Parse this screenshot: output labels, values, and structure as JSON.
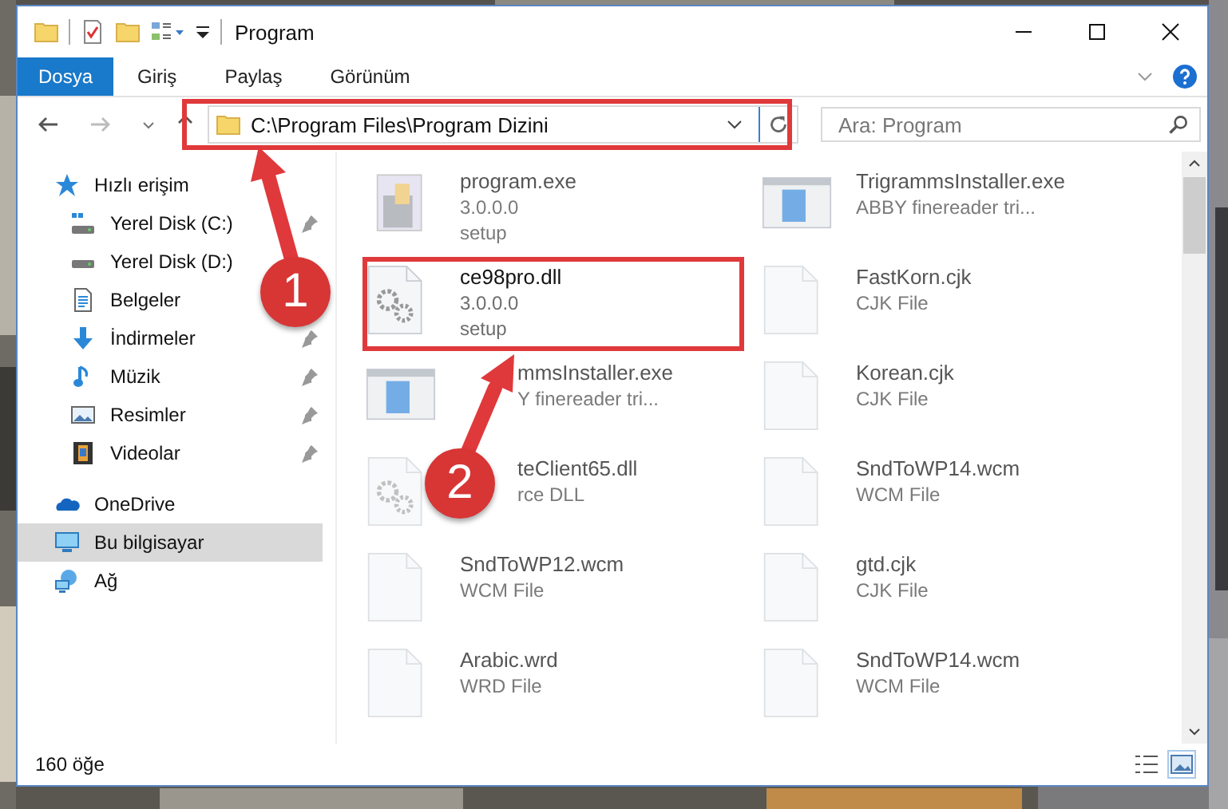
{
  "window": {
    "title": "Program"
  },
  "ribbon": {
    "tabs": [
      {
        "label": "Dosya",
        "kind": "file"
      },
      {
        "label": "Giriş",
        "kind": "tab"
      },
      {
        "label": "Paylaş",
        "kind": "tab"
      },
      {
        "label": "Görünüm",
        "kind": "tab"
      }
    ]
  },
  "address_bar": {
    "path": "C:\\Program Files\\Program Dizini"
  },
  "search": {
    "placeholder": "Ara: Program"
  },
  "sidebar": {
    "items": [
      {
        "label": "Hızlı erişim",
        "selected": false,
        "children": [
          {
            "label": "Yerel Disk (C:)",
            "pinned": true
          },
          {
            "label": "Yerel Disk (D:)",
            "pinned": false
          },
          {
            "label": "Belgeler",
            "pinned": false
          },
          {
            "label": "İndirmeler",
            "pinned": true
          },
          {
            "label": "Müzik",
            "pinned": true
          },
          {
            "label": "Resimler",
            "pinned": true
          },
          {
            "label": "Videolar",
            "pinned": true
          }
        ]
      },
      {
        "label": "OneDrive",
        "selected": false
      },
      {
        "label": "Bu bilgisayar",
        "selected": true
      },
      {
        "label": "Ağ",
        "selected": false
      }
    ]
  },
  "files": [
    {
      "kind": "program",
      "lines": [
        "program.exe",
        "3.0.0.0",
        "setup"
      ]
    },
    {
      "kind": "installer",
      "lines": [
        "TrigrammsInstaller.exe",
        "ABBY finereader tri..."
      ]
    },
    {
      "kind": "dll",
      "lines": [
        "ce98pro.dll",
        "3.0.0.0",
        "setup"
      ],
      "focused": true
    },
    {
      "kind": "blank",
      "lines": [
        "FastKorn.cjk",
        "CJK File"
      ]
    },
    {
      "kind": "installer",
      "lines": [
        "mmsInstaller.exe",
        "Y finereader tri..."
      ],
      "partly_hidden": true
    },
    {
      "kind": "blank",
      "lines": [
        "Korean.cjk",
        "CJK File"
      ]
    },
    {
      "kind": "dll",
      "lines": [
        "teClient65.dll",
        "rce DLL"
      ],
      "partly_hidden": true
    },
    {
      "kind": "blank",
      "lines": [
        "SndToWP14.wcm",
        "WCM File"
      ]
    },
    {
      "kind": "blank",
      "lines": [
        "SndToWP12.wcm",
        "WCM File"
      ]
    },
    {
      "kind": "blank",
      "lines": [
        "gtd.cjk",
        "CJK File"
      ]
    },
    {
      "kind": "blank",
      "lines": [
        "Arabic.wrd",
        "WRD File"
      ]
    },
    {
      "kind": "blank",
      "lines": [
        "SndToWP14.wcm",
        "WCM File"
      ]
    }
  ],
  "status_bar": {
    "count": "160 öğe"
  },
  "annotations": [
    {
      "label": "1"
    },
    {
      "label": "2"
    }
  ]
}
